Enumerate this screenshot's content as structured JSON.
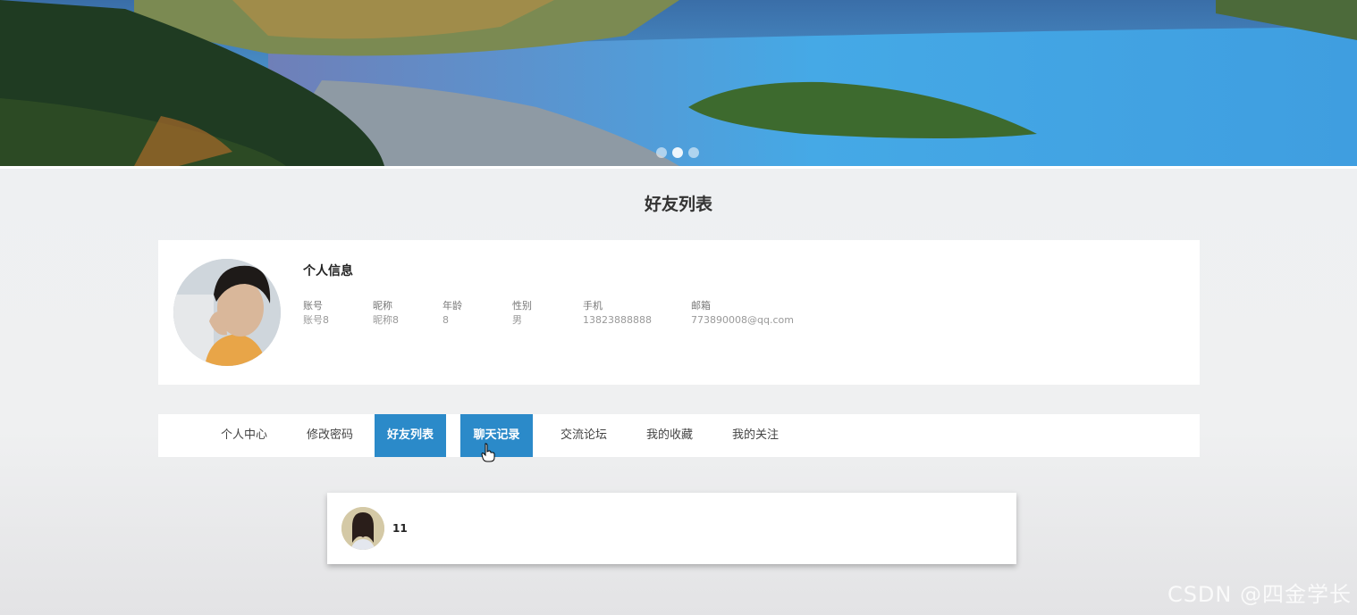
{
  "banner": {
    "slides": 3,
    "active_slide": 1
  },
  "page_title": "好友列表",
  "profile": {
    "section_title": "个人信息",
    "fields": [
      {
        "label": "账号",
        "value": "账号8"
      },
      {
        "label": "昵称",
        "value": "昵称8"
      },
      {
        "label": "年龄",
        "value": "8"
      },
      {
        "label": "性别",
        "value": "男"
      },
      {
        "label": "手机",
        "value": "13823888888"
      },
      {
        "label": "邮箱",
        "value": "773890008@qq.com"
      }
    ]
  },
  "tabs": [
    {
      "label": "个人中心"
    },
    {
      "label": "修改密码"
    },
    {
      "label": "好友列表"
    },
    {
      "label": "聊天记录"
    },
    {
      "label": "交流论坛"
    },
    {
      "label": "我的收藏"
    },
    {
      "label": "我的关注"
    }
  ],
  "friends": [
    {
      "name": "11"
    }
  ],
  "watermark": "CSDN @四金学长",
  "colors": {
    "accent": "#2b8ac9",
    "background": "#eef0f2"
  }
}
